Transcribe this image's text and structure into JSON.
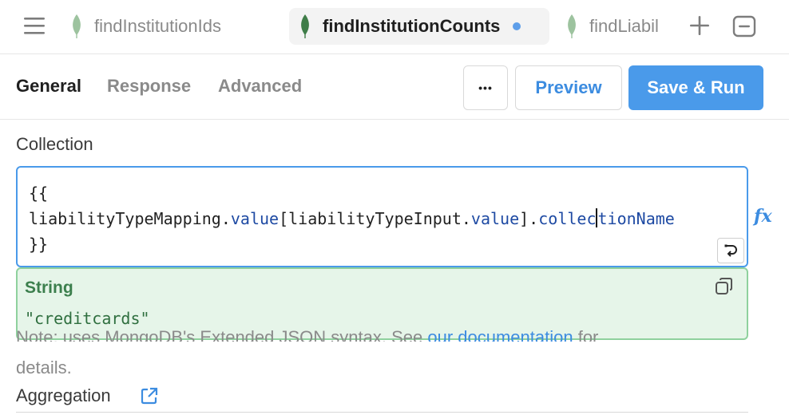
{
  "tabs": [
    {
      "label": "findInstitutionIds",
      "active": false
    },
    {
      "label": "findInstitutionCounts",
      "active": true,
      "unsaved": true
    },
    {
      "label": "findLiabil",
      "active": false
    }
  ],
  "subtabs": [
    "General",
    "Response",
    "Advanced"
  ],
  "toolbar": {
    "more_label": "•••",
    "preview_label": "Preview",
    "save_run_label": "Save & Run"
  },
  "collection": {
    "label": "Collection",
    "code_line1": "{{",
    "code_line2": {
      "p1": "liabilityTypeMapping.",
      "p2": "value",
      "p3": "[liabilityTypeInput.",
      "p4": "value",
      "p5": "].",
      "p6a": "collec",
      "p6b": "tionName"
    },
    "code_line3": "}}",
    "fx_label": "fx",
    "evaluated": {
      "type": "String",
      "value": "\"creditcards\""
    }
  },
  "note": {
    "text_start": "Note: uses MongoDB's Extended JSON syntax. See ",
    "link": "our documentation",
    "text_end": " for",
    "details": "details."
  },
  "aggregation": {
    "label": "Aggregation"
  },
  "colors": {
    "accent": "#4a9aea",
    "popover_bg": "#e6f5e9",
    "popover_border": "#8fd19e",
    "leaf_green": "#4f8a52"
  }
}
